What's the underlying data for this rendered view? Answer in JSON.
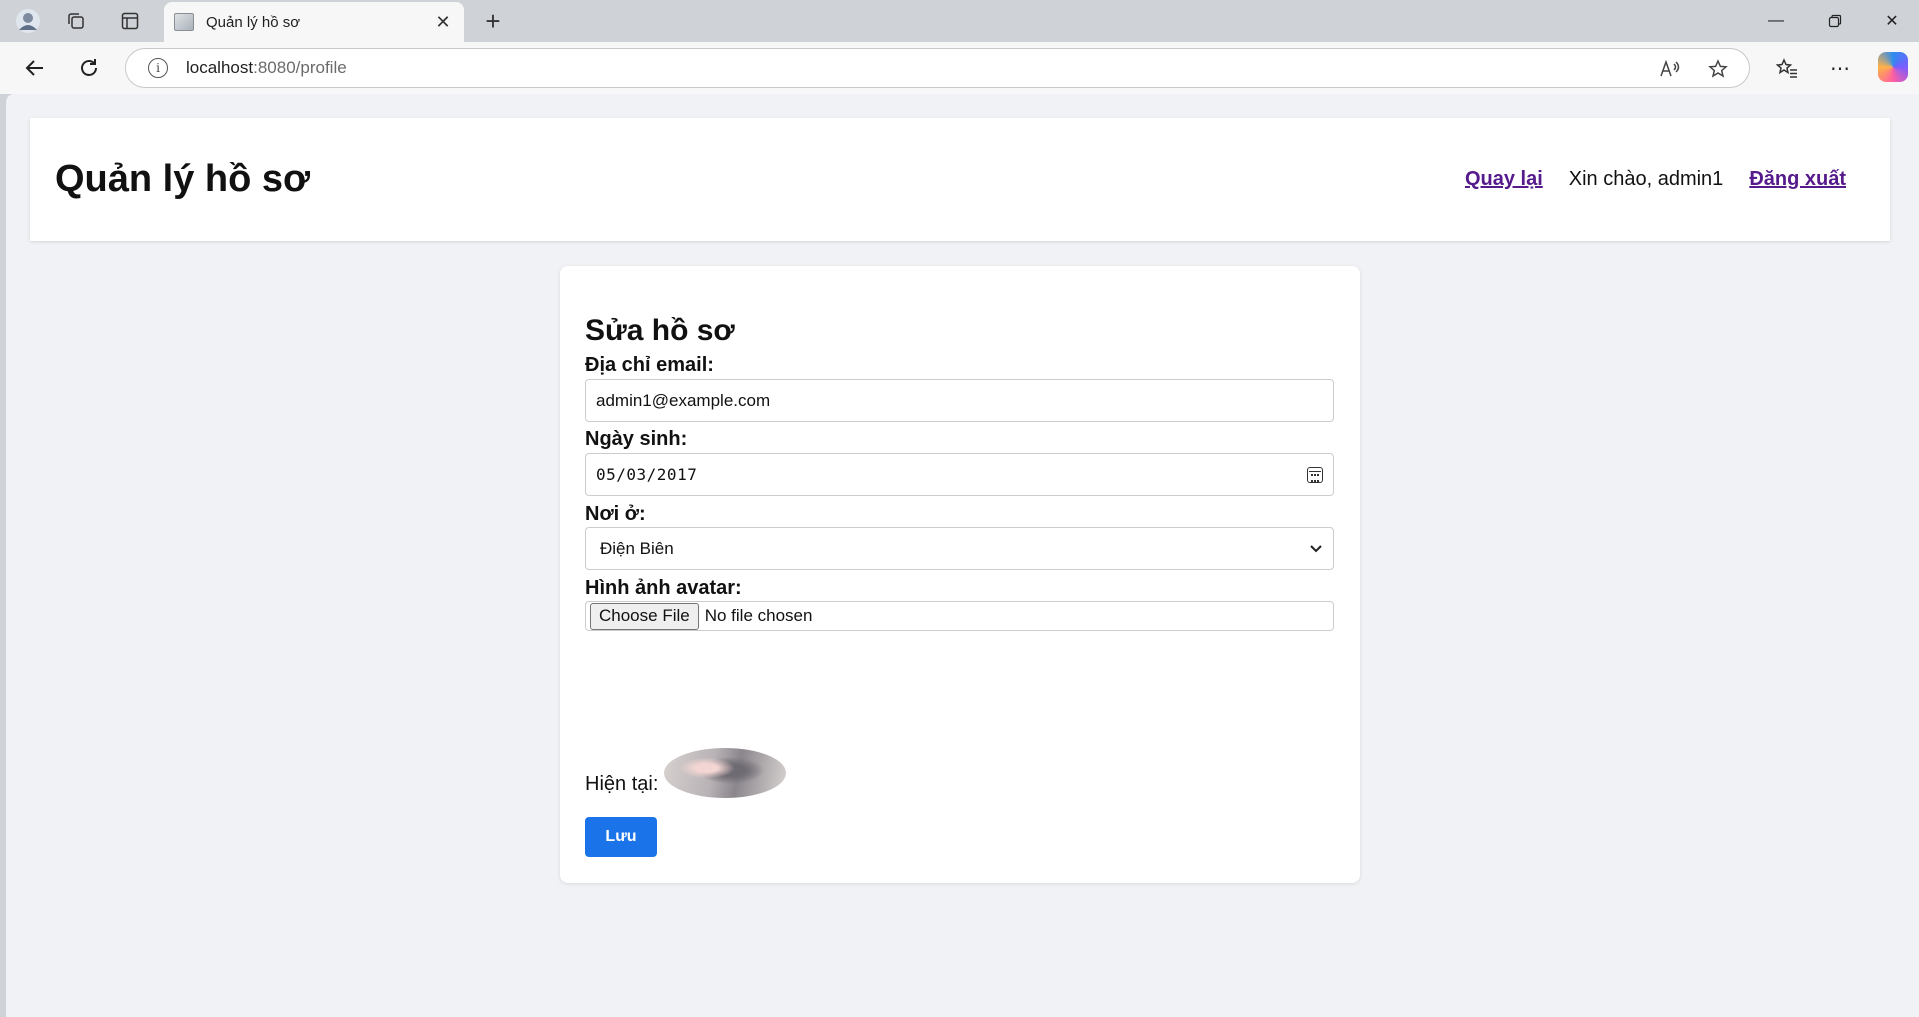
{
  "browser": {
    "tab_title": "Quản lý hồ sơ",
    "url_host": "localhost",
    "url_rest": ":8080/profile"
  },
  "header": {
    "title": "Quản lý hồ sơ",
    "back_link": "Quay lại",
    "greeting": "Xin chào, admin1",
    "logout_link": "Đăng xuất"
  },
  "form": {
    "title": "Sửa hồ sơ",
    "email_label": "Địa chỉ email:",
    "email_value": "admin1@example.com",
    "dob_label": "Ngày sinh:",
    "dob_value": "05/03/2017",
    "residence_label": "Nơi ở:",
    "residence_value": "Điện Biên",
    "avatar_label": "Hình ảnh avatar:",
    "choose_file_label": "Choose File",
    "file_status": "No file chosen",
    "current_label": "Hiện tại:",
    "save_label": "Lưu"
  },
  "colors": {
    "accent": "#1a73e8",
    "link": "#551a8b",
    "page_bg": "#f0f2f5"
  }
}
